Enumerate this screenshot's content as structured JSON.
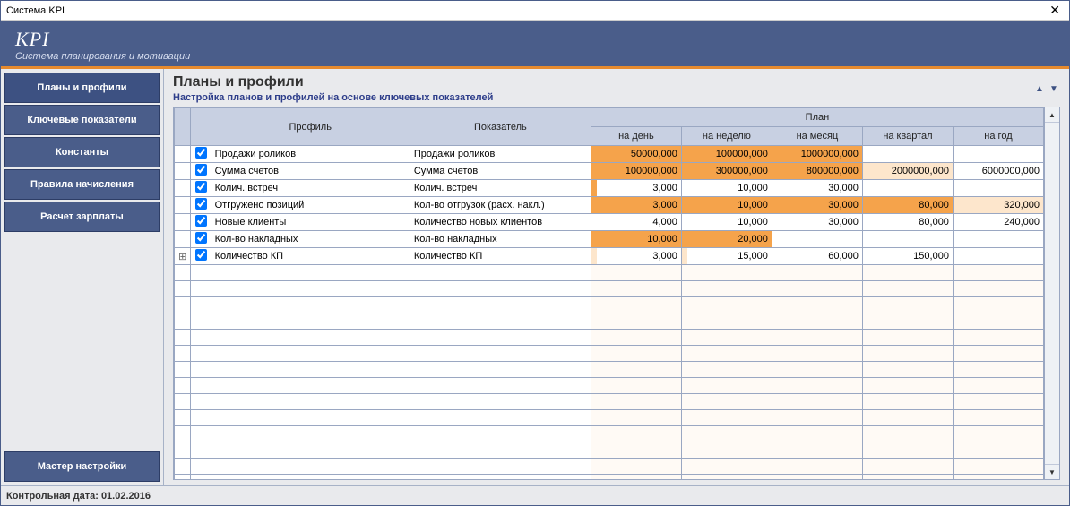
{
  "window": {
    "title": "Система KPI",
    "close": "✕"
  },
  "header": {
    "title": "KPI",
    "subtitle": "Система планирования и мотивации"
  },
  "sidebar": {
    "items": [
      {
        "label": "Планы и профили",
        "active": true
      },
      {
        "label": "Ключевые показатели",
        "active": false
      },
      {
        "label": "Константы",
        "active": false
      },
      {
        "label": "Правила начисления",
        "active": false
      },
      {
        "label": "Расчет зарплаты",
        "active": false
      }
    ],
    "bottom": {
      "label": "Мастер настройки"
    }
  },
  "main": {
    "title": "Планы и профили",
    "subtitle": "Настройка планов и профилей на основе ключевых показателей",
    "columns": {
      "profile": "Профиль",
      "indicator": "Показатель",
      "plan_group": "План",
      "day": "на день",
      "week": "на неделю",
      "month": "на месяц",
      "quarter": "на квартал",
      "year": "на год"
    },
    "rows": [
      {
        "checked": true,
        "profile": "Продажи роликов",
        "indicator": "Продажи роликов",
        "day": {
          "value": "50000,000",
          "hl": "strong"
        },
        "week": {
          "value": "100000,000",
          "hl": "strong"
        },
        "month": {
          "value": "1000000,000",
          "hl": "strong"
        },
        "quarter": {
          "value": "",
          "hl": ""
        },
        "year": {
          "value": "",
          "hl": ""
        }
      },
      {
        "checked": true,
        "profile": "Сумма счетов",
        "indicator": "Сумма счетов",
        "day": {
          "value": "100000,000",
          "hl": "strong"
        },
        "week": {
          "value": "300000,000",
          "hl": "strong"
        },
        "month": {
          "value": "800000,000",
          "hl": "strong"
        },
        "quarter": {
          "value": "2000000,000",
          "hl": "light"
        },
        "year": {
          "value": "6000000,000",
          "hl": ""
        }
      },
      {
        "checked": true,
        "profile": "Колич. встреч",
        "indicator": "Колич. встреч",
        "day": {
          "value": "3,000",
          "hl": "marker"
        },
        "week": {
          "value": "10,000",
          "hl": ""
        },
        "month": {
          "value": "30,000",
          "hl": ""
        },
        "quarter": {
          "value": "",
          "hl": ""
        },
        "year": {
          "value": "",
          "hl": ""
        }
      },
      {
        "checked": true,
        "profile": "Отгружено позиций",
        "indicator": "Кол-во отгрузок (расх. накл.)",
        "day": {
          "value": "3,000",
          "hl": "strong"
        },
        "week": {
          "value": "10,000",
          "hl": "strong"
        },
        "month": {
          "value": "30,000",
          "hl": "strong"
        },
        "quarter": {
          "value": "80,000",
          "hl": "strong"
        },
        "year": {
          "value": "320,000",
          "hl": "light"
        }
      },
      {
        "checked": true,
        "profile": "Новые клиенты",
        "indicator": "Количество новых клиентов",
        "day": {
          "value": "4,000",
          "hl": ""
        },
        "week": {
          "value": "10,000",
          "hl": ""
        },
        "month": {
          "value": "30,000",
          "hl": ""
        },
        "quarter": {
          "value": "80,000",
          "hl": ""
        },
        "year": {
          "value": "240,000",
          "hl": ""
        }
      },
      {
        "checked": true,
        "profile": "Кол-во накладных",
        "indicator": "Кол-во накладных",
        "day": {
          "value": "10,000",
          "hl": "strong"
        },
        "week": {
          "value": "20,000",
          "hl": "strong"
        },
        "month": {
          "value": "",
          "hl": ""
        },
        "quarter": {
          "value": "",
          "hl": ""
        },
        "year": {
          "value": "",
          "hl": ""
        }
      },
      {
        "checked": true,
        "expandable": true,
        "profile": "Количество КП",
        "indicator": "Количество КП",
        "day": {
          "value": "3,000",
          "hl": "marker-light"
        },
        "week": {
          "value": "15,000",
          "hl": "marker-light"
        },
        "month": {
          "value": "60,000",
          "hl": ""
        },
        "quarter": {
          "value": "150,000",
          "hl": ""
        },
        "year": {
          "value": "",
          "hl": ""
        }
      }
    ]
  },
  "status": {
    "label": "Контрольная дата: 01.02.2016"
  }
}
